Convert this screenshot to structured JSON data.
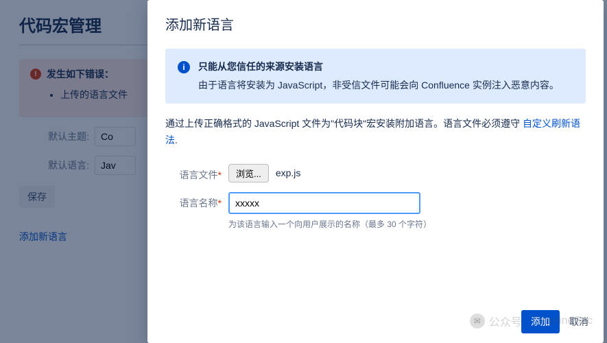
{
  "bg": {
    "title": "代码宏管理",
    "error": {
      "heading": "发生如下错误：",
      "items": [
        "上传的语言文件"
      ]
    },
    "rows": {
      "theme_label": "默认主题:",
      "theme_value": "Co",
      "lang_label": "默认语言:",
      "lang_value": "Jav"
    },
    "save": "保存",
    "add_link": "添加新语言"
  },
  "modal": {
    "title": "添加新语言",
    "info": {
      "title": "只能从您信任的来源安装语言",
      "body": "由于语言将安装为 JavaScript，非受信文件可能会向 Confluence 实例注入恶意内容。"
    },
    "para": {
      "pre": "通过上传正确格式的 JavaScript 文件为\"代码块\"宏安装附加语言。语言文件必须遵守 ",
      "link": "自定义刷新语法",
      "post": "."
    },
    "file": {
      "label": "语言文件",
      "browse": "浏览...",
      "name": "exp.js"
    },
    "name": {
      "label": "语言名称",
      "value": "xxxxx",
      "hint": "为该语言输入一个向用户展示的名称（最多 30 个字符）"
    },
    "actions": {
      "primary": "添加",
      "cancel": "取消"
    }
  },
  "watermark": {
    "prefix": "公众号 ·",
    "brand": "TimelineSec"
  }
}
